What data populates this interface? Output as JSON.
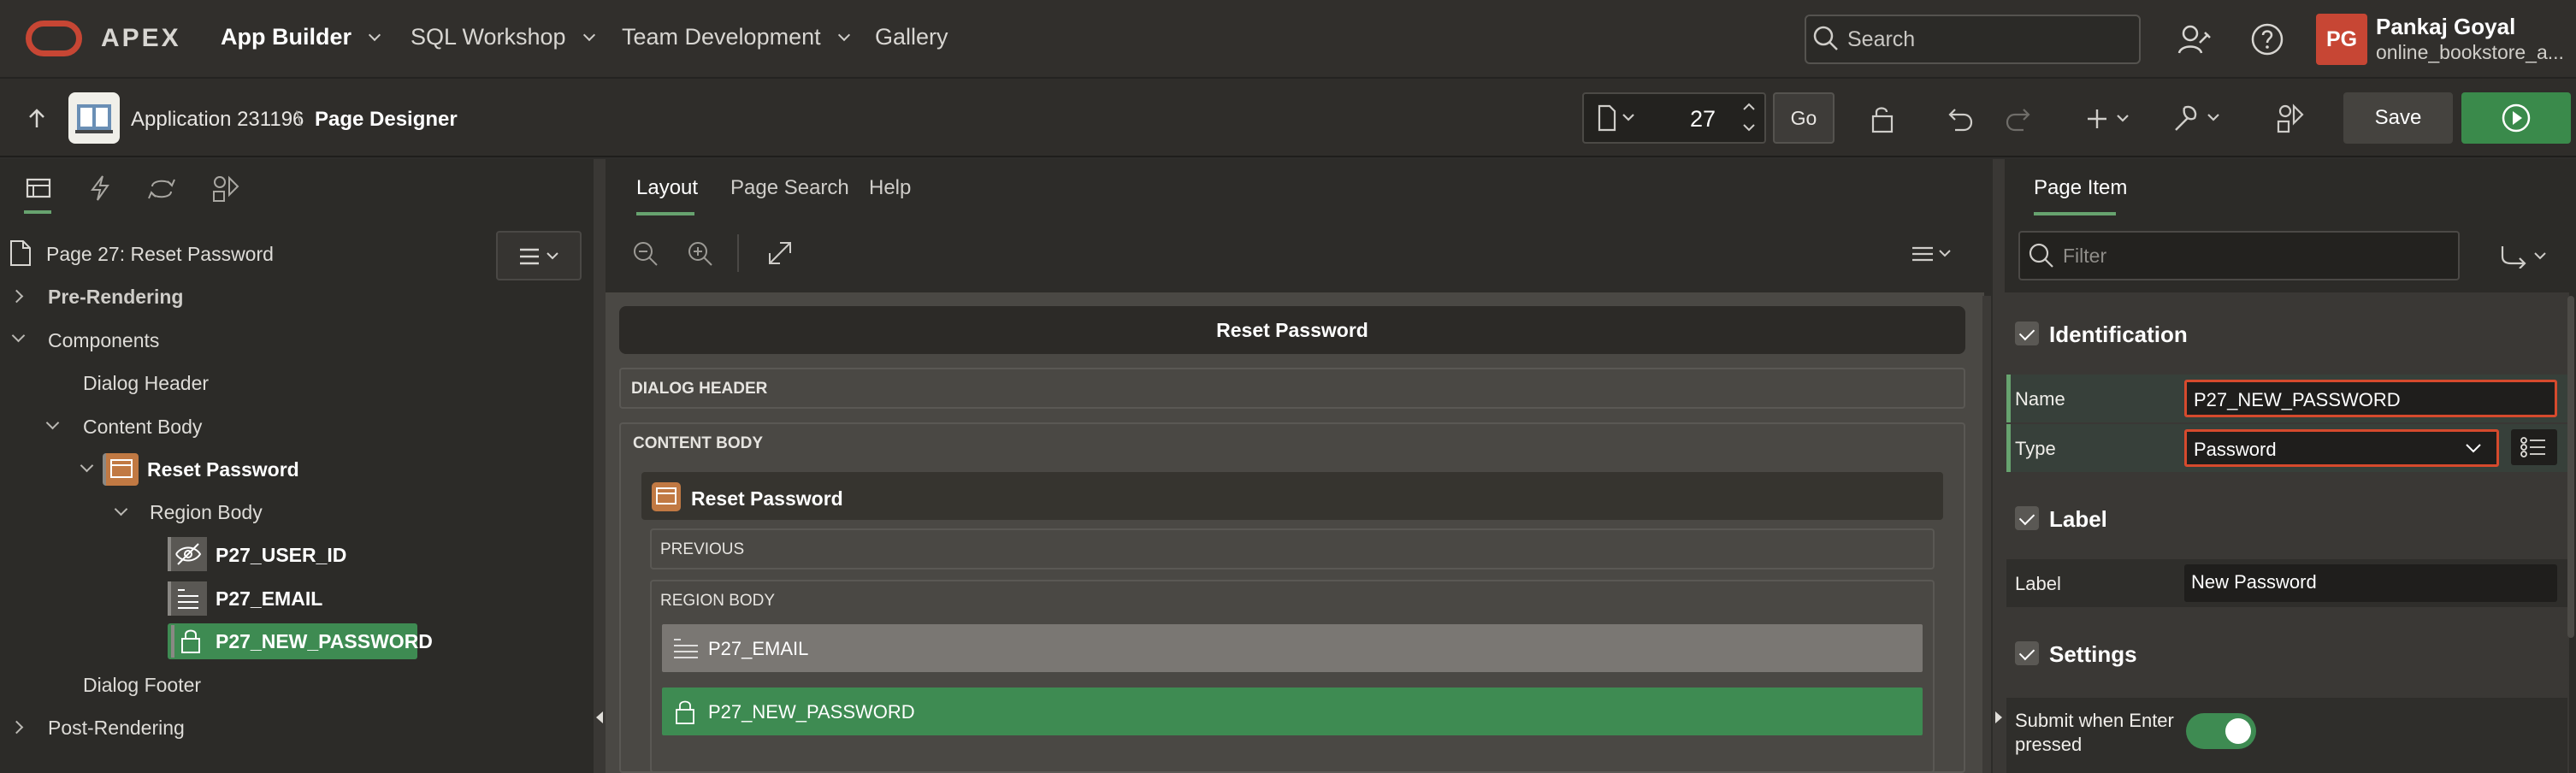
{
  "header": {
    "brand": "APEX",
    "nav": [
      {
        "label": "App Builder"
      },
      {
        "label": "SQL Workshop"
      },
      {
        "label": "Team Development"
      },
      {
        "label": "Gallery"
      }
    ],
    "search_placeholder": "Search",
    "user": {
      "initials": "PG",
      "name": "Pankaj Goyal",
      "workspace": "online_bookstore_a..."
    }
  },
  "toolbar": {
    "app_label": "Application 231196",
    "separator": "\\",
    "page_label": "Page Designer",
    "page_number": "27",
    "go_label": "Go",
    "save_label": "Save"
  },
  "left": {
    "page_node": "Page 27: Reset Password",
    "tree": {
      "pre_rendering": "Pre-Rendering",
      "components": "Components",
      "dialog_header": "Dialog Header",
      "content_body": "Content Body",
      "reset_password": "Reset Password",
      "region_body": "Region Body",
      "items": [
        "P27_USER_ID",
        "P27_EMAIL",
        "P27_NEW_PASSWORD"
      ],
      "dialog_footer": "Dialog Footer",
      "post_rendering": "Post-Rendering"
    }
  },
  "center": {
    "tabs": [
      "Layout",
      "Page Search",
      "Help"
    ],
    "dialog_title": "Reset Password",
    "dialog_header": "DIALOG HEADER",
    "content_body": "CONTENT BODY",
    "region_title": "Reset Password",
    "previous": "PREVIOUS",
    "region_body": "REGION BODY",
    "item_email": "P27_EMAIL",
    "item_password": "P27_NEW_PASSWORD"
  },
  "right": {
    "tab": "Page Item",
    "filter_placeholder": "Filter",
    "groups": {
      "identification": "Identification",
      "label": "Label",
      "settings": "Settings"
    },
    "name_label": "Name",
    "name_value": "P27_NEW_PASSWORD",
    "type_label": "Type",
    "type_value": "Password",
    "label_label": "Label",
    "label_value": "New Password",
    "submit_label_1": "Submit when Enter",
    "submit_label_2": "pressed",
    "submit_on": true
  },
  "colors": {
    "brand": "#c74634",
    "accent": "#3e8b52",
    "error": "#d64a2d"
  }
}
